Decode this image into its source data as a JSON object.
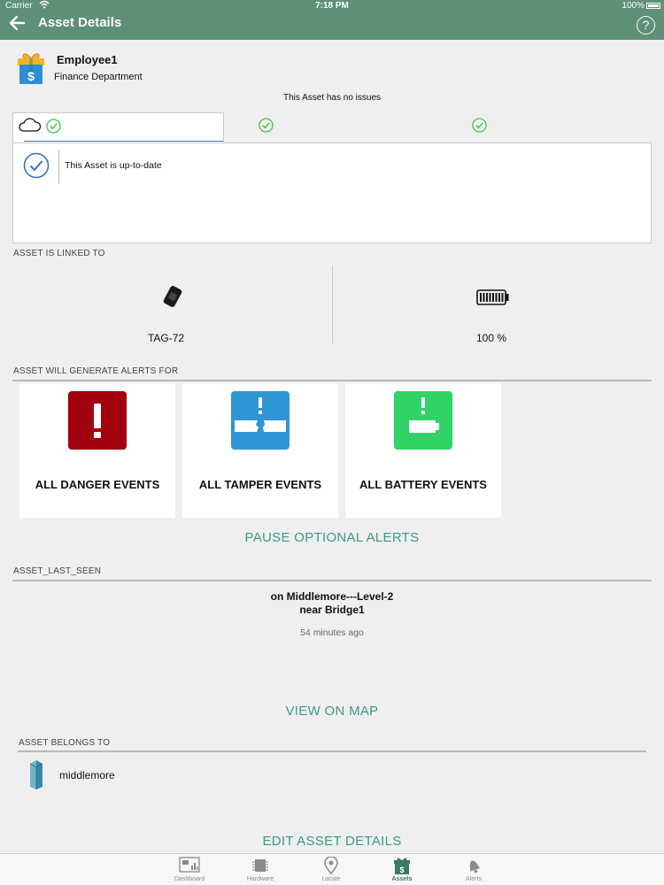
{
  "status_bar": {
    "carrier": "Carrier",
    "time": "7:18 PM",
    "battery": "100%"
  },
  "nav": {
    "title": "Asset Details",
    "help": "?"
  },
  "employee": {
    "name": "Employee1",
    "department": "Finance Department"
  },
  "status_summary": "This Asset has no issues",
  "info_panel": {
    "message": "This Asset is up-to-date"
  },
  "linked": {
    "section_label": "ASSET IS LINKED TO",
    "tag_label": "TAG-72",
    "battery_label": "100 %"
  },
  "alerts": {
    "section_label": "ASSET WILL GENERATE ALERTS FOR",
    "cards": [
      {
        "label": "ALL DANGER EVENTS",
        "color": "#a1020d",
        "icon": "danger-icon"
      },
      {
        "label": "ALL TAMPER EVENTS",
        "color": "#2d96d4",
        "icon": "tamper-icon"
      },
      {
        "label": "ALL BATTERY EVENTS",
        "color": "#2fd366",
        "icon": "battery-alert-icon"
      }
    ],
    "pause_label": "PAUSE OPTIONAL ALERTS"
  },
  "last_seen": {
    "section_label": "ASSET_LAST_SEEN",
    "location_line1": "on Middlemore---Level-2",
    "location_line2": "near Bridge1",
    "ago": "54 minutes ago",
    "map_label": "VIEW ON MAP"
  },
  "belongs": {
    "section_label": "ASSET BELONGS TO",
    "site": "middlemore"
  },
  "edit_label": "EDIT ASSET DETAILS",
  "tab_bar": {
    "items": [
      {
        "label": "Dashboard",
        "icon": "dashboard-icon"
      },
      {
        "label": "Hardware",
        "icon": "chip-icon"
      },
      {
        "label": "Locate",
        "icon": "location-pin-icon"
      },
      {
        "label": "Assets",
        "icon": "gift-dollar-icon"
      },
      {
        "label": "Alerts",
        "icon": "bell-icon"
      }
    ],
    "selected": "Assets"
  },
  "colors": {
    "header": "#5d9077",
    "accent_link": "#3a9a82",
    "ok_green": "#3cc73c"
  }
}
